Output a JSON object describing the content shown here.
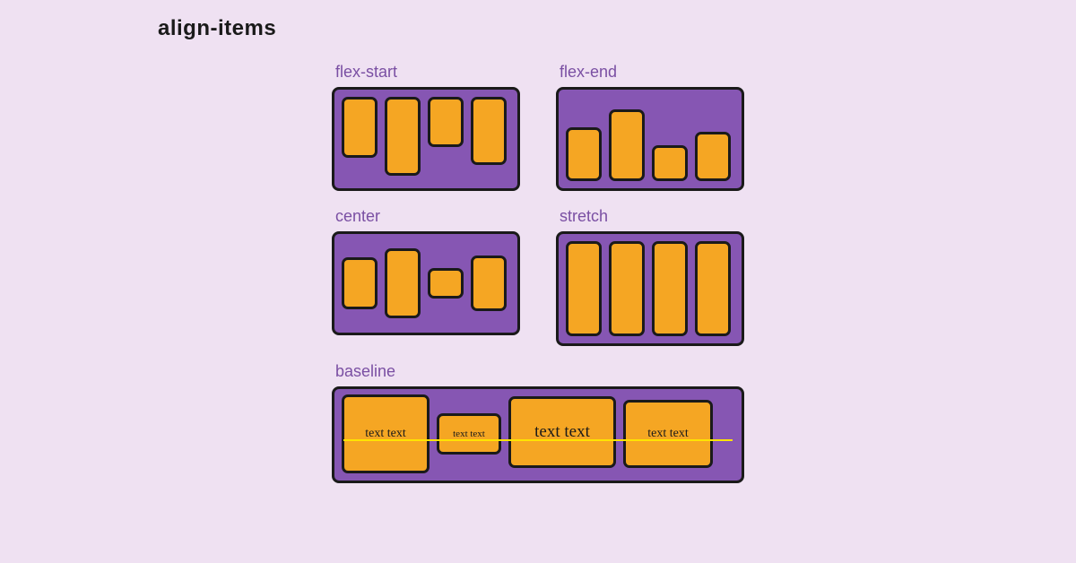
{
  "title": "align-items",
  "examples": {
    "flex_start": {
      "label": "flex-start"
    },
    "flex_end": {
      "label": "flex-end"
    },
    "center": {
      "label": "center"
    },
    "stretch": {
      "label": "stretch"
    },
    "baseline": {
      "label": "baseline",
      "items": [
        "text text",
        "text text",
        "text text",
        "text text"
      ]
    }
  }
}
